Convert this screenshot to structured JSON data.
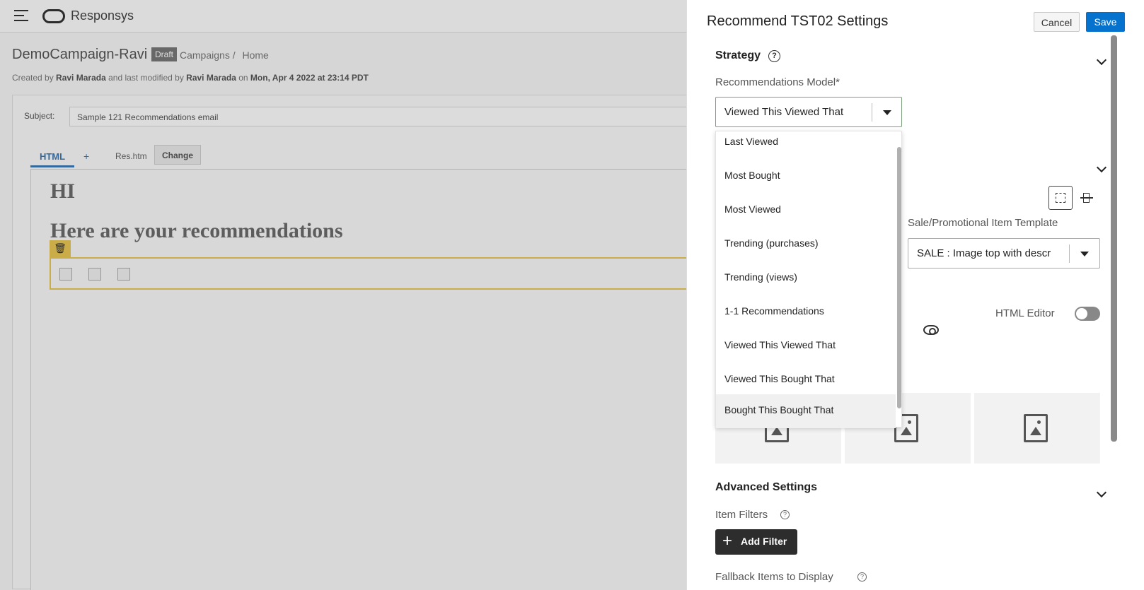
{
  "app": {
    "brand": "Responsys",
    "campaign_title": "DemoCampaign-Ravi",
    "status_badge": "Draft",
    "breadcrumbs": [
      "Campaigns /",
      "Home"
    ],
    "meta": {
      "created_by_prefix": "Created by",
      "created_by": "Ravi Marada",
      "modified_prefix": "and last modified by",
      "modified_by": "Ravi Marada",
      "on_prefix": "on",
      "modified_date": "Mon, Apr 4 2022 at 23:14 PDT"
    },
    "subject_label": "Subject:",
    "subject_value": "Sample 121 Recommendations email",
    "tab_html": "HTML",
    "tab_add": "+",
    "file_name": "Res.htm",
    "change_button": "Change",
    "content": {
      "heading1": "HI",
      "heading2": "Here are your recommendations",
      "trash_icon": "🗑"
    }
  },
  "panel": {
    "title": "Recommend TST02 Settings",
    "cancel_label": "Cancel",
    "save_label": "Save",
    "strategy": {
      "title": "Strategy",
      "help": "?",
      "model_label": "Recommendations Model*",
      "model_value": "Viewed This Viewed That",
      "options": [
        "Last Viewed",
        "Most Bought",
        "Most Viewed",
        "Trending (purchases)",
        "Trending (views)",
        "1-1 Recommendations",
        "Viewed This Viewed That",
        "Viewed This Bought That",
        "Bought This Bought That"
      ],
      "highlighted_option_index": 8
    },
    "template": {
      "label": "Sale/Promotional Item Template",
      "value": "SALE : Image top with descr"
    },
    "html_editor": {
      "label": "HTML Editor",
      "enabled": false
    },
    "advanced": {
      "title": "Advanced Settings",
      "item_filters_label": "Item Filters",
      "help": "?",
      "add_filter_label": "Add Filter",
      "add_filter_plus": "+",
      "fallback_label": "Fallback Items to Display"
    }
  }
}
